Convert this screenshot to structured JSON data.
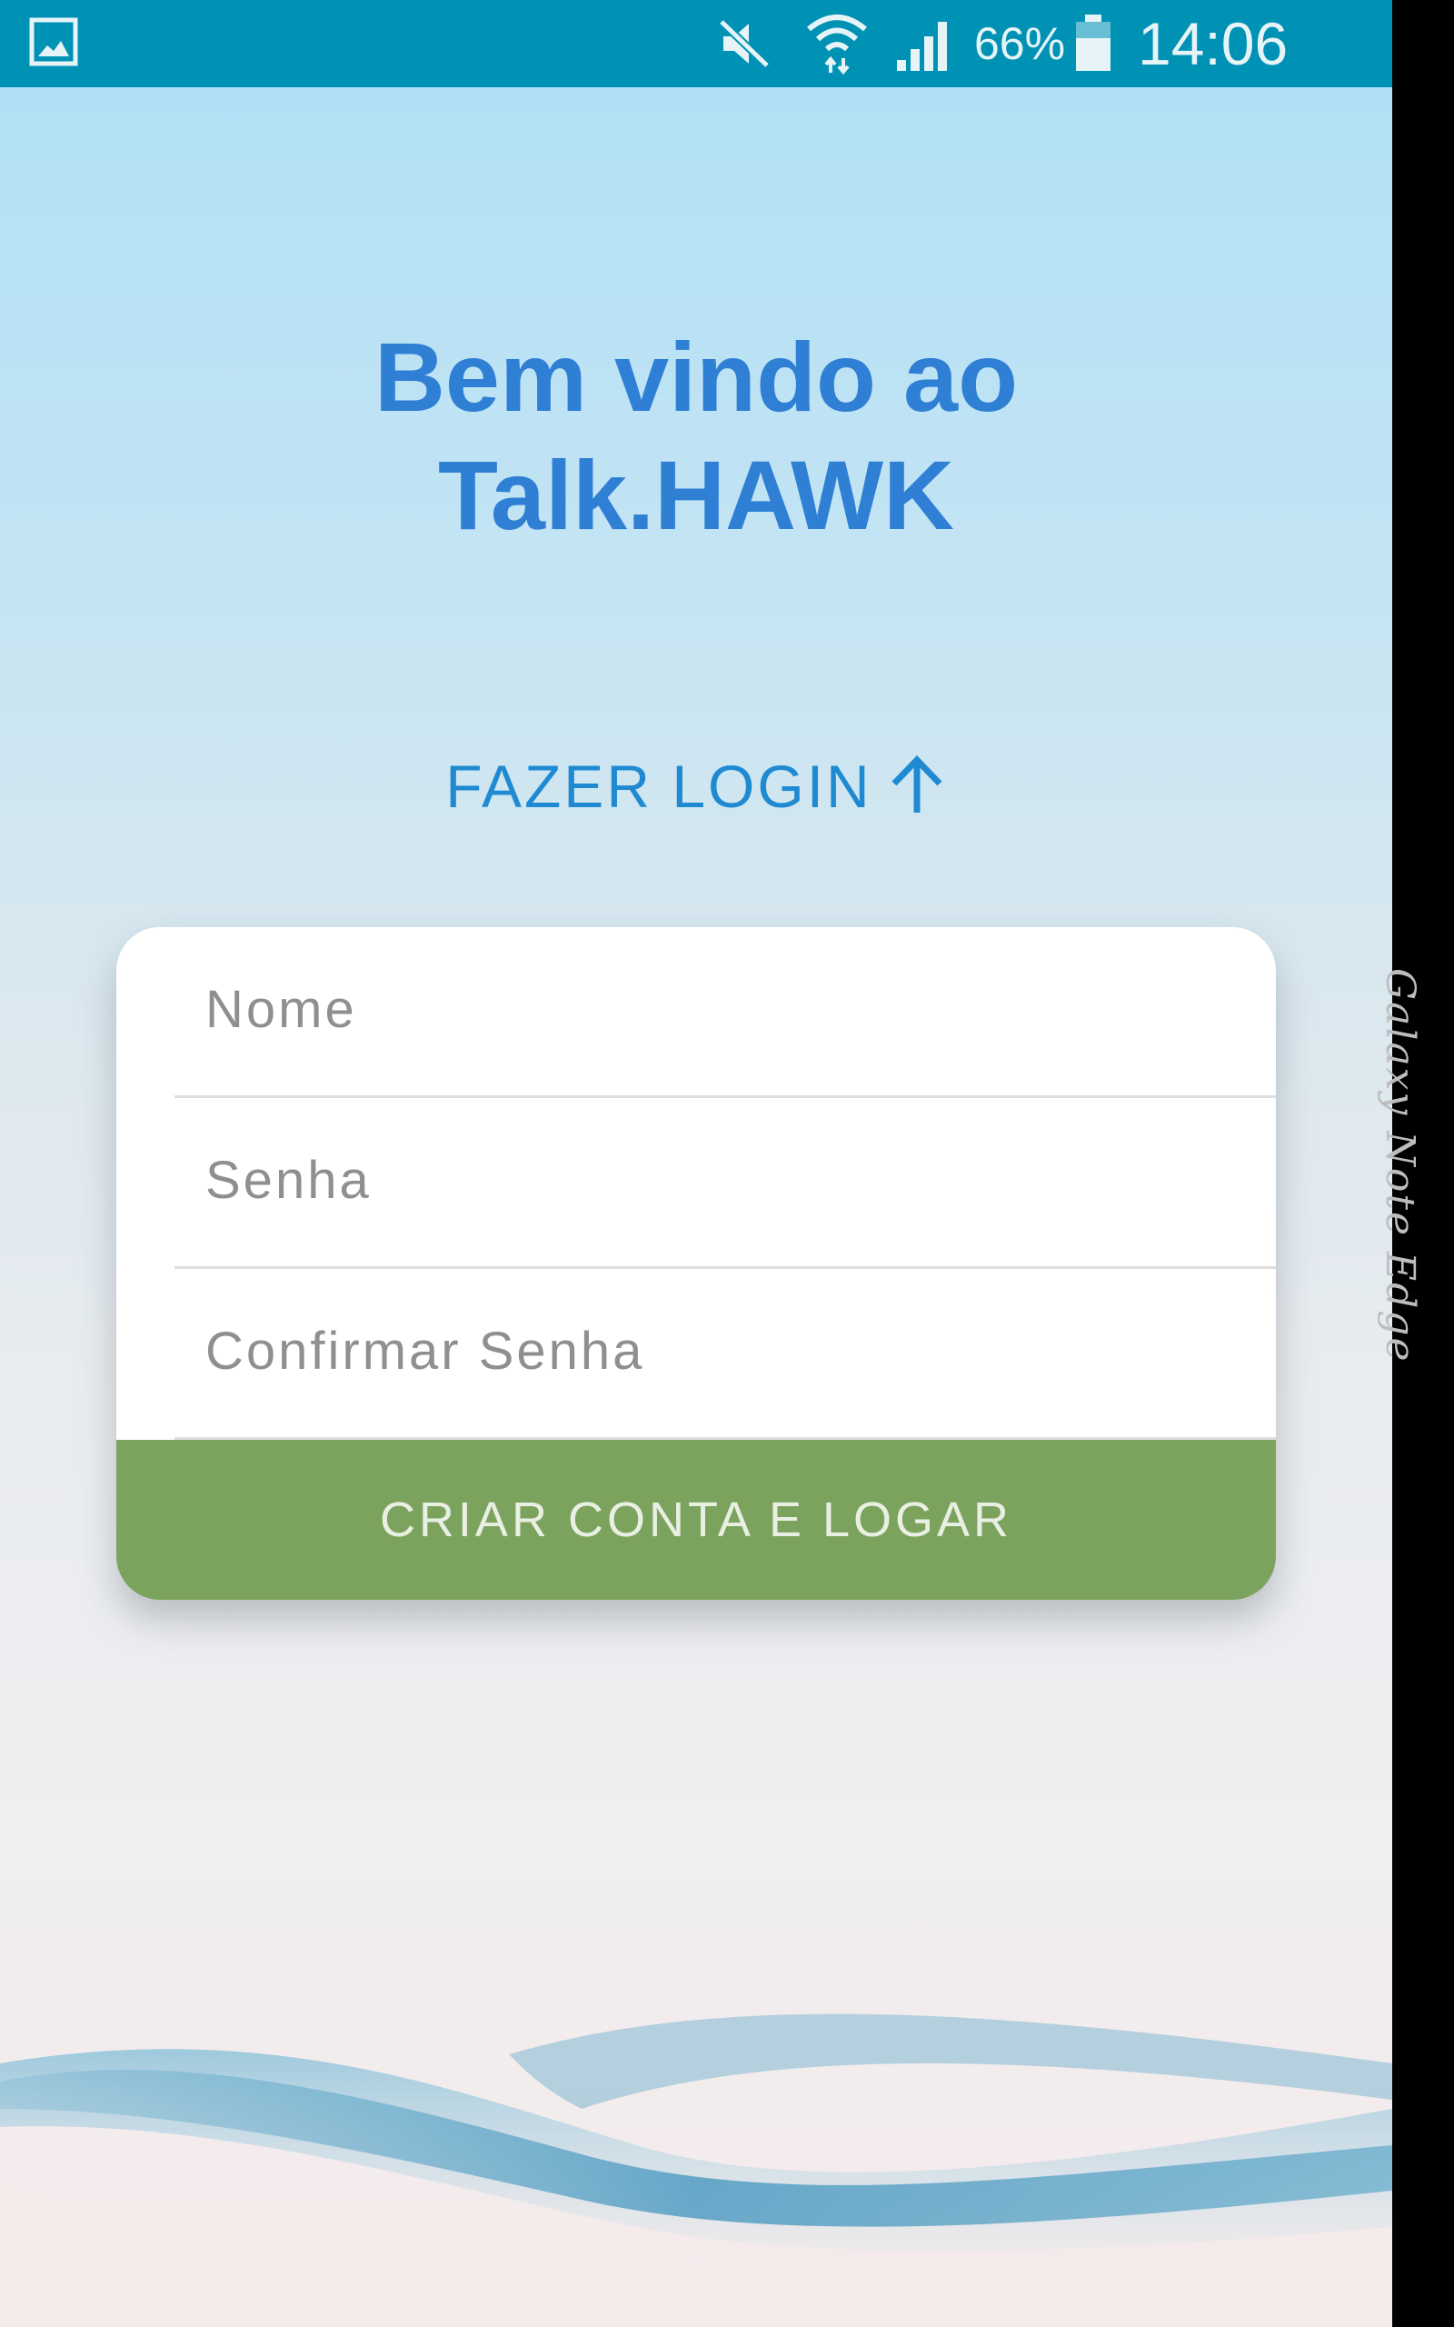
{
  "status_bar": {
    "battery_percent": "66%",
    "time": "14:06",
    "icons": [
      "gallery-icon",
      "mute-icon",
      "wifi-icon",
      "signal-icon",
      "battery-icon"
    ]
  },
  "welcome": {
    "line1": "Bem vindo ao",
    "line2": "Talk.HAWK"
  },
  "login_link": {
    "label": "FAZER LOGIN",
    "icon": "arrow-up-icon"
  },
  "form": {
    "name_field": {
      "placeholder": "Nome",
      "value": ""
    },
    "password_field": {
      "placeholder": "Senha",
      "value": ""
    },
    "confirm_field": {
      "placeholder": "Confirmar Senha",
      "value": ""
    },
    "submit_label": "CRIAR CONTA E LOGAR"
  },
  "device": {
    "edge_label": "Galaxy Note Edge"
  },
  "colors": {
    "status_bar": "#0092b5",
    "title": "#2f7fd4",
    "link": "#1f8ad1",
    "button": "#7ca35e"
  }
}
